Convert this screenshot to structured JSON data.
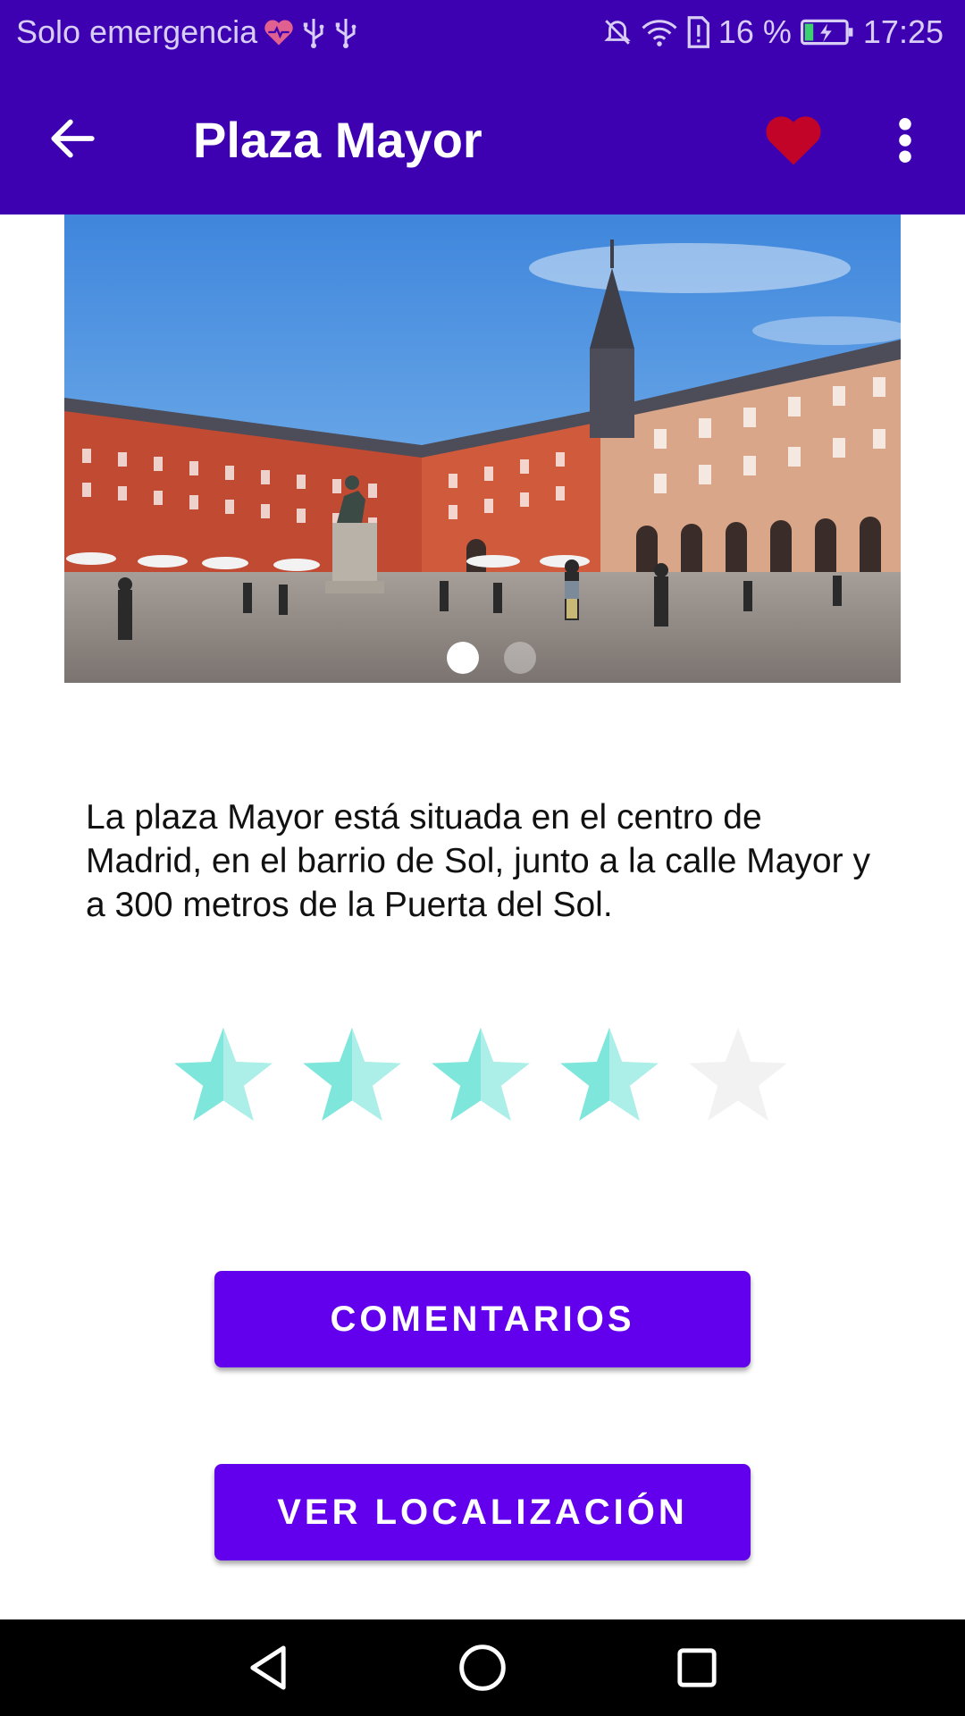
{
  "status_bar": {
    "carrier": "Solo emergencia",
    "battery": "16 %",
    "time": "17:25"
  },
  "app_bar": {
    "title": "Plaza Mayor",
    "favorite_color": "#c10428"
  },
  "carousel": {
    "pages": 2,
    "current_page": 1
  },
  "description": "La plaza Mayor está situada en el centro de Madrid, en el barrio de Sol, junto a la calle Mayor y a 300 metros de la Puerta del Sol.",
  "rating": {
    "value": 4,
    "max": 5,
    "filled_color": "#7fe6dc",
    "empty_color": "#f2f2f2"
  },
  "buttons": {
    "comments": "COMENTARIOS",
    "location": "VER LOCALIZACIÓN"
  },
  "colors": {
    "primary_dark": "#3d01b1",
    "accent": "#6200ee"
  }
}
